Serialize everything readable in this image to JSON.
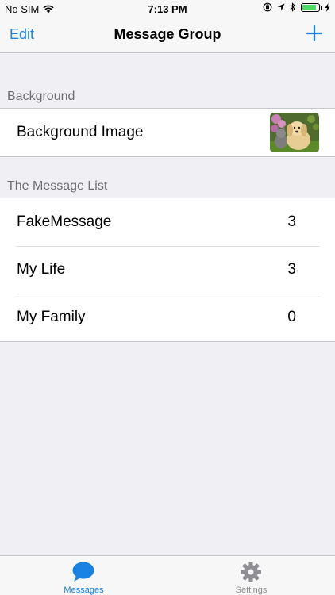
{
  "status_bar": {
    "carrier": "No SIM",
    "time": "7:13 PM",
    "battery_level": 0.85
  },
  "nav_bar": {
    "left_button": "Edit",
    "title": "Message Group",
    "right_icon": "plus-icon"
  },
  "background_section": {
    "header": "Background",
    "row_label": "Background Image",
    "thumbnail": "puppy-and-kitten-photo"
  },
  "message_list_section": {
    "header": "The Message List",
    "rows": [
      {
        "label": "FakeMessage",
        "count": "3"
      },
      {
        "label": "My Life",
        "count": "3"
      },
      {
        "label": "My Family",
        "count": "0"
      }
    ]
  },
  "tab_bar": {
    "tabs": [
      {
        "label": "Messages",
        "icon": "speech-bubble-icon",
        "active": true
      },
      {
        "label": "Settings",
        "icon": "gear-icon",
        "active": false
      }
    ]
  },
  "colors": {
    "accent": "#1a82e2",
    "background": "#efeff4",
    "inactive": "#8e8e93"
  }
}
